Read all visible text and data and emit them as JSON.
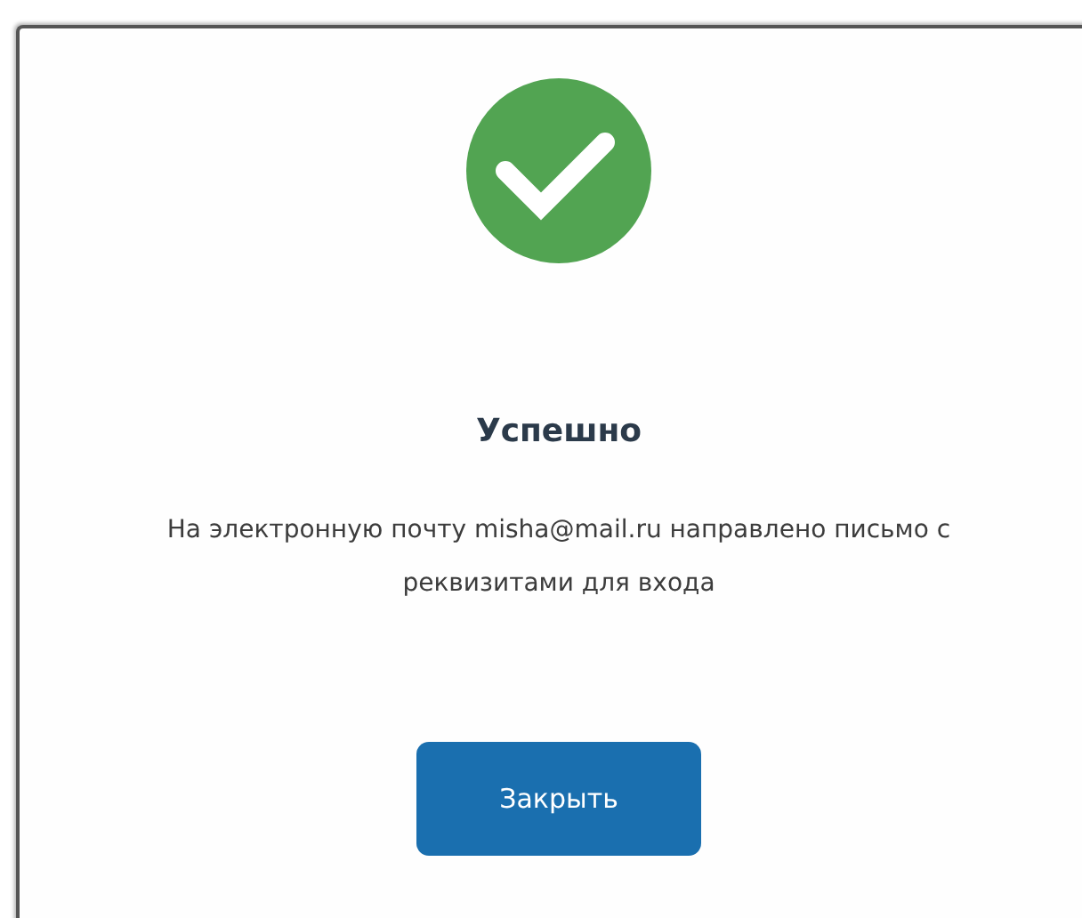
{
  "dialog": {
    "kind": "success",
    "title": "Успешно",
    "message": "На электронную почту misha@mail.ru направлено письмо с реквизитами для входа",
    "button": "Закрыть"
  }
}
